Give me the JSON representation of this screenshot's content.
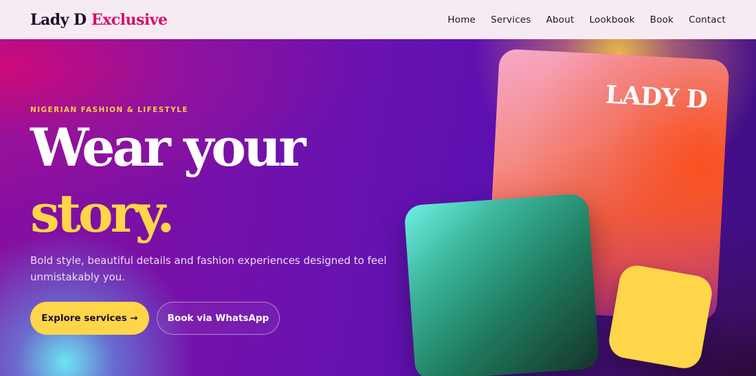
{
  "header": {
    "brand_main": "Lady D",
    "brand_accent": "Exclusive",
    "nav": [
      "Home",
      "Services",
      "About",
      "Lookbook",
      "Book",
      "Contact"
    ]
  },
  "hero": {
    "eyebrow": "NIGERIAN FASHION & LIFESTYLE",
    "headline_line1": "Wear your",
    "headline_line2": "story.",
    "subtext": "Bold style, beautiful details and fashion experiences designed to feel unmistakably you.",
    "cta_primary": "Explore services →",
    "cta_secondary": "Book via WhatsApp",
    "card_label": "LADY D"
  },
  "colors": {
    "accent_pink": "#d4126d",
    "accent_yellow": "#ffd54a",
    "header_bg": "#f7ebf3"
  }
}
